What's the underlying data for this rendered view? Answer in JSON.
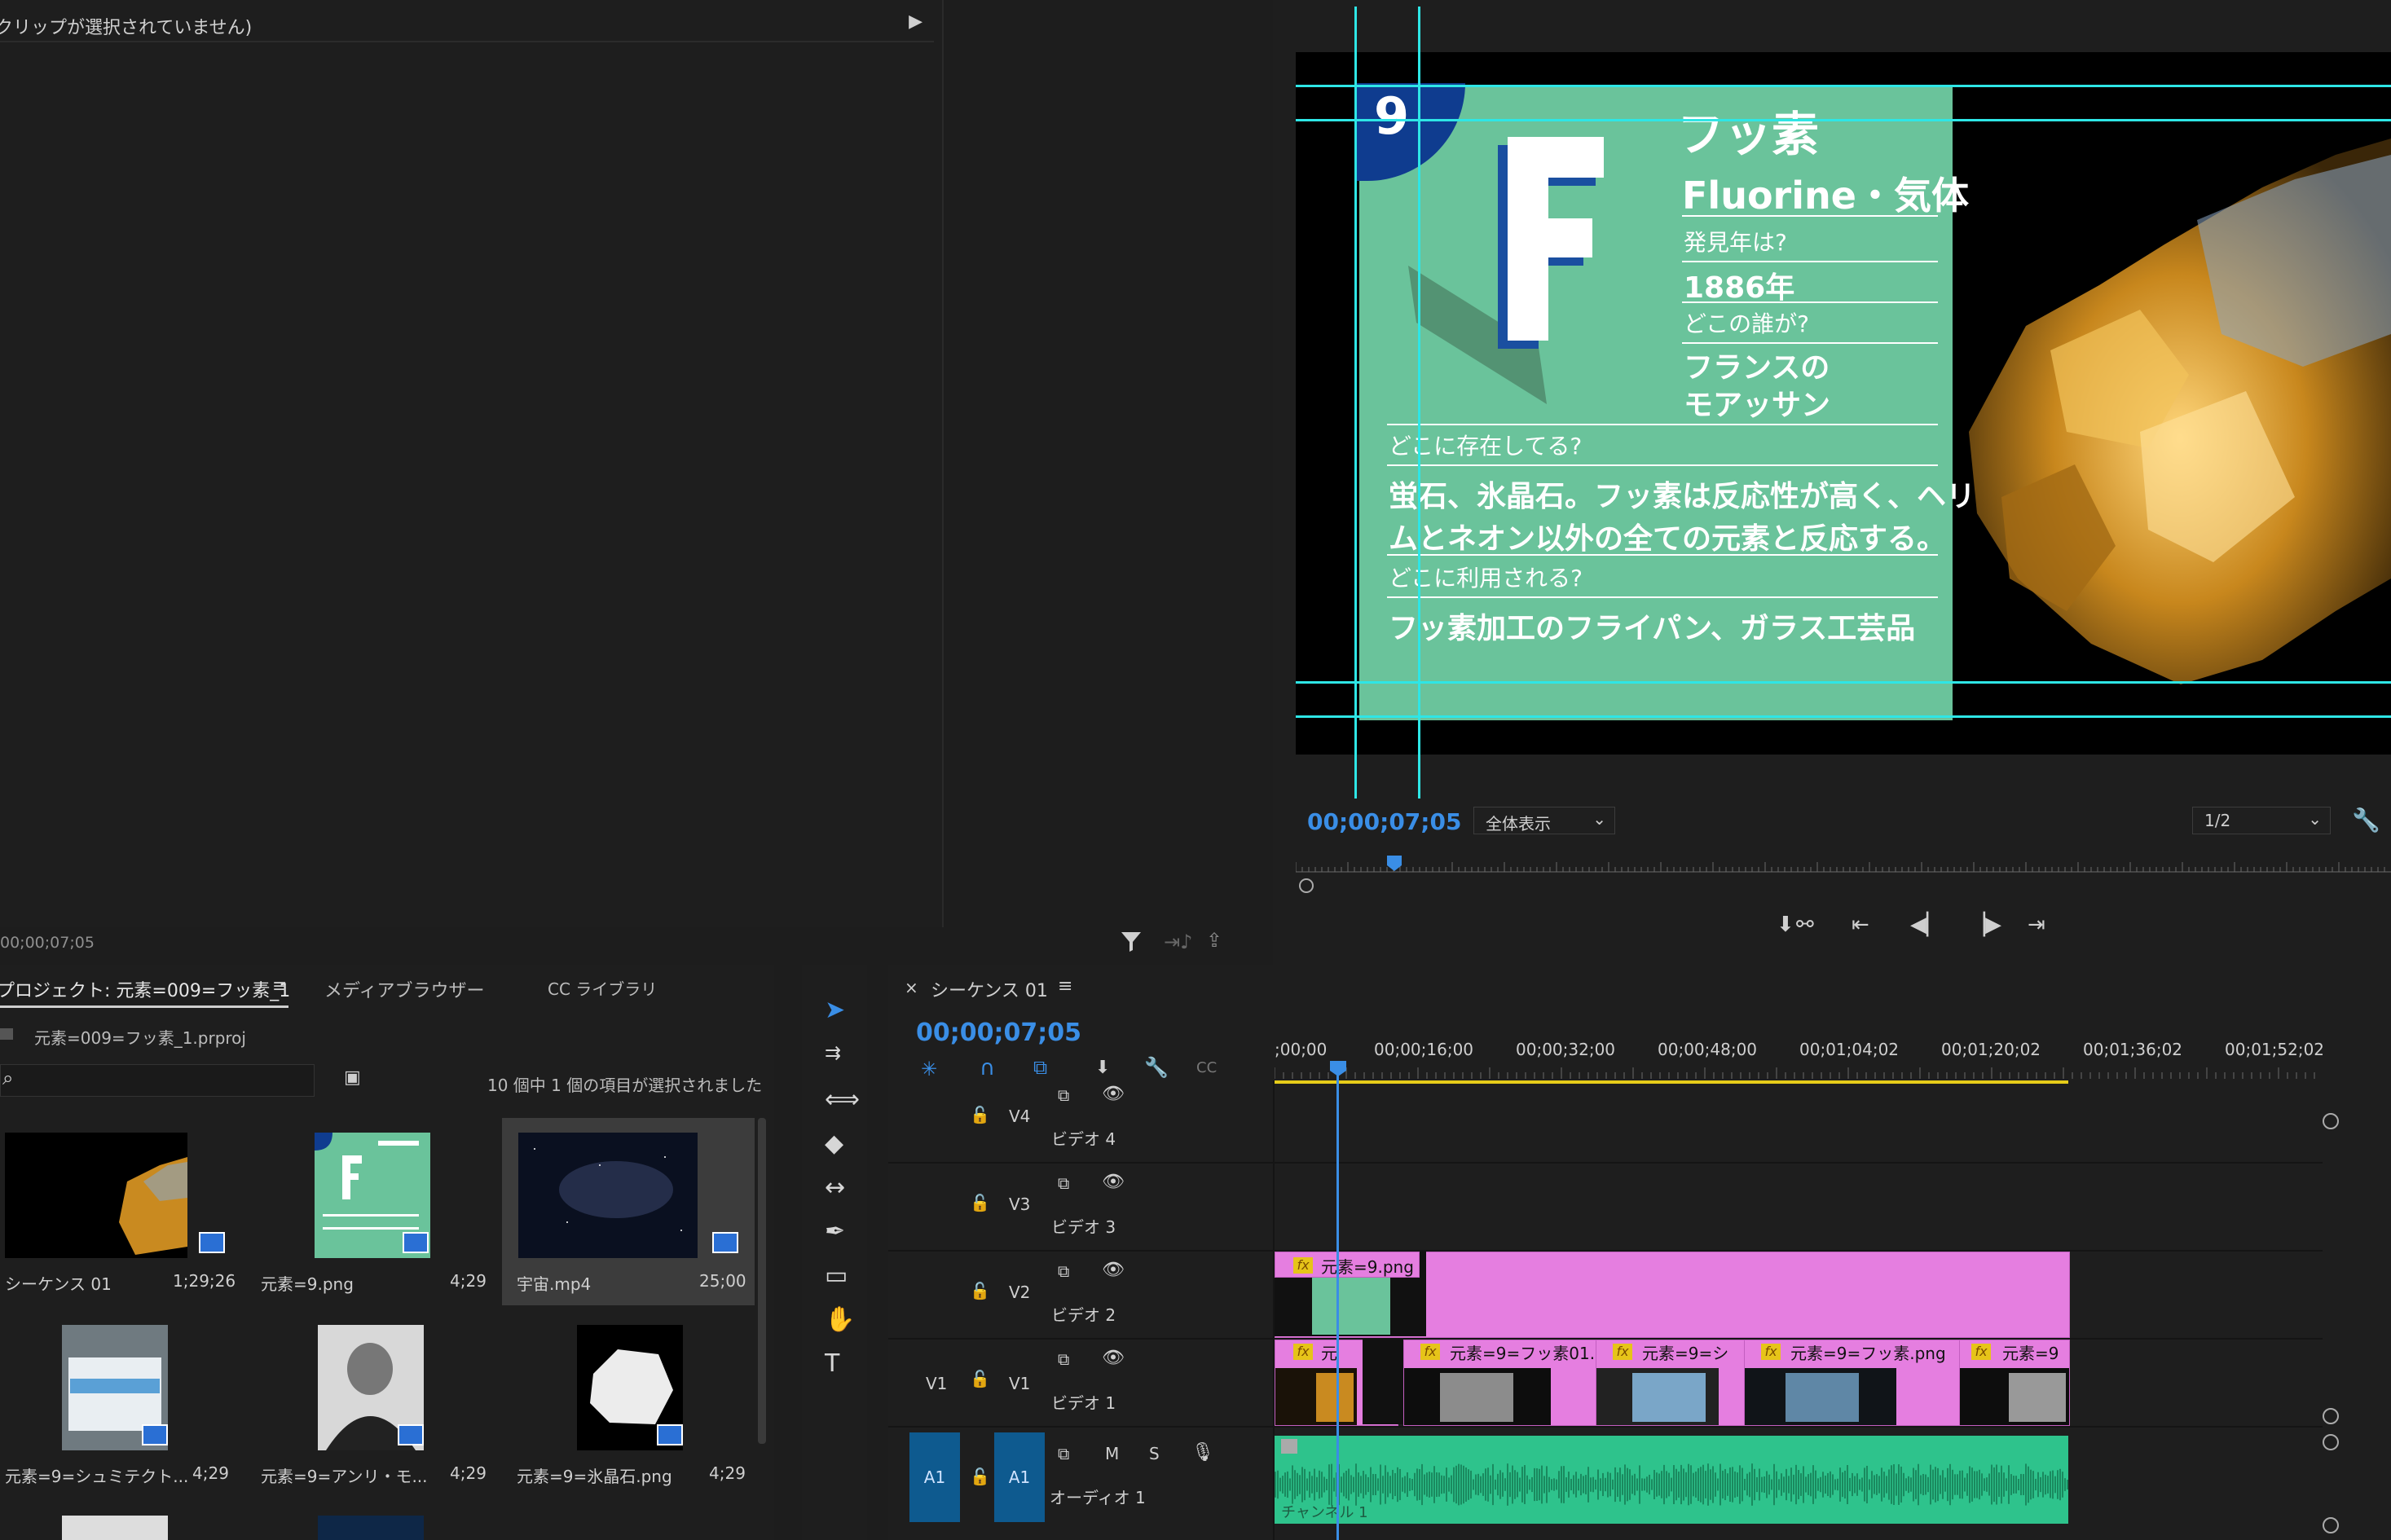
{
  "source_panel": {
    "header": "クリップが選択されていません)",
    "timecode": "00;00;07;05"
  },
  "program": {
    "card": {
      "number": "9",
      "letter": "F",
      "title": "フッ素",
      "subtitle": "Fluorine・気体",
      "q1": "発見年は?",
      "a1": "1886年",
      "q2": "どこの誰が?",
      "a2_1": "フランスの",
      "a2_2": "モアッサン",
      "q3": "どこに存在してる?",
      "a3_1": "蛍石、氷晶石。フッ素は反応性が高く、ヘリウ",
      "a3_2": "ムとネオン以外の全ての元素と反応する。",
      "q4": "どこに利用される?",
      "a4": "フッ素加工のフライパン、ガラス工芸品"
    },
    "timecode": "00;00;07;05",
    "zoom": "全体表示",
    "resolution": "1/2"
  },
  "project": {
    "tabs": [
      "プロジェクト: 元素=009=フッ素_1",
      "メディアブラウザー",
      "CC ライブラリ"
    ],
    "file": "元素=009=フッ素_1.prproj",
    "selection_count": "10 個中 1 個の項目が選択されました",
    "items": [
      {
        "name": "シーケンス 01",
        "duration": "1;29;26"
      },
      {
        "name": "元素=9.png",
        "duration": "4;29"
      },
      {
        "name": "宇宙.mp4",
        "duration": "25;00"
      },
      {
        "name": "元素=9=シュミテクト...",
        "duration": "4;29"
      },
      {
        "name": "元素=9=アンリ・モ...",
        "duration": "4;29"
      },
      {
        "name": "元素=9=氷晶石.png",
        "duration": "4;29"
      }
    ]
  },
  "timeline": {
    "title": "シーケンス 01",
    "timecode": "00;00;07;05",
    "ruler": [
      ";00;00",
      "00;00;16;00",
      "00;00;32;00",
      "00;00;48;00",
      "00;01;04;02",
      "00;01;20;02",
      "00;01;36;02",
      "00;01;52;02"
    ],
    "tracks": {
      "v4": {
        "id": "V4",
        "name": "ビデオ 4"
      },
      "v3": {
        "id": "V3",
        "name": "ビデオ 3"
      },
      "v2": {
        "id": "V2",
        "name": "ビデオ 2"
      },
      "v1": {
        "id": "V1",
        "name": "ビデオ 1",
        "source": "V1"
      },
      "a1": {
        "id": "A1",
        "name": "オーディオ 1",
        "source": "A1",
        "m": "M",
        "s": "S"
      }
    },
    "clips_v2": [
      "元素=9.png"
    ],
    "clips_v1": [
      "元",
      "元素=9=フッ素01.",
      "元素=9=シ",
      "元素=9=フッ素.png",
      "元素=9"
    ],
    "audio_channel": "チャンネル 1"
  },
  "colors": {
    "accent": "#3a8ee6",
    "card": "#6ac39b",
    "clip": "#e57ee0",
    "audio": "#2ec38c",
    "guides": "#2ee6e6"
  }
}
